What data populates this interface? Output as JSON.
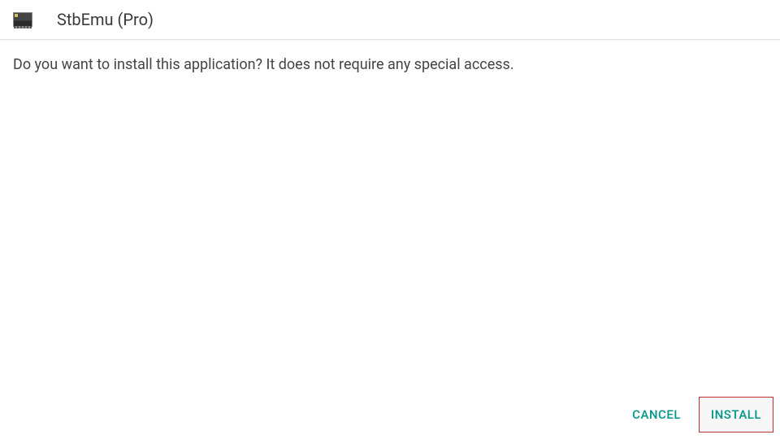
{
  "header": {
    "app_name": "StbEmu (Pro)"
  },
  "dialog": {
    "message": "Do you want to install this application? It does not require any special access."
  },
  "buttons": {
    "cancel": "CANCEL",
    "install": "INSTALL"
  }
}
